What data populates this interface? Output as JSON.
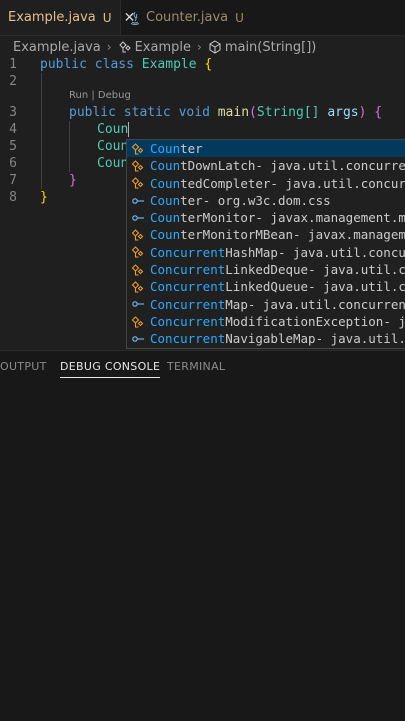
{
  "tabs": [
    {
      "name": "Example.java",
      "mark": "U",
      "close": "✕"
    },
    {
      "name": "Counter.java",
      "mark": "U"
    }
  ],
  "breadcrumb": {
    "file": "Example.java",
    "cls": "Example",
    "method": "main(String[])",
    "sep": "›"
  },
  "code": {
    "line_numbers": [
      "1",
      "2",
      "3",
      "4",
      "5",
      "6",
      "7",
      "8"
    ],
    "codelens": "Run | Debug",
    "l1_kw1": "public",
    "l1_kw2": "class",
    "l1_cls": "Example",
    "l1_brace": "{",
    "l3_kw1": "public",
    "l3_kw2": "static",
    "l3_kw3": "void",
    "l3_fn": "main",
    "l3_open": "(",
    "l3_type": "String[]",
    "l3_param": "args",
    "l3_close": ")",
    "l3_brace": "{",
    "l4_text": "Coun",
    "l5_text": "Coun",
    "l6_text": "Coun",
    "l7_brace": "}",
    "l8_brace": "}"
  },
  "suggestions": [
    {
      "icon": "class-icon",
      "match": "Coun",
      "rest": "ter",
      "detail": ""
    },
    {
      "icon": "class-icon",
      "match": "Coun",
      "rest": "tDownLatch",
      "detail": " - java.util.concurrent"
    },
    {
      "icon": "class-icon",
      "match": "Coun",
      "rest": "tedCompleter",
      "detail": " - java.util.concurrent"
    },
    {
      "icon": "interface-icon",
      "match": "Coun",
      "rest": "ter",
      "detail": " - org.w3c.dom.css"
    },
    {
      "icon": "interface-icon",
      "match": "Coun",
      "rest": "terMonitor",
      "detail": " - javax.management.monitor"
    },
    {
      "icon": "class-icon",
      "match": "Coun",
      "rest": "terMonitorMBean",
      "detail": " - javax.management.monitor"
    },
    {
      "icon": "class-icon",
      "match": "Concurrent",
      "rest": "HashMap",
      "detail": " - java.util.concurrent"
    },
    {
      "icon": "class-icon",
      "match": "Concurrent",
      "rest": "LinkedDeque",
      "detail": " - java.util.concurrent"
    },
    {
      "icon": "class-icon",
      "match": "Concurrent",
      "rest": "LinkedQueue",
      "detail": " - java.util.concurrent"
    },
    {
      "icon": "interface-icon",
      "match": "Concurrent",
      "rest": "Map",
      "detail": " - java.util.concurrent"
    },
    {
      "icon": "class-icon",
      "match": "Concurrent",
      "rest": "ModificationException",
      "detail": " - java.util"
    },
    {
      "icon": "interface-icon",
      "match": "Concurrent",
      "rest": "NavigableMap",
      "detail": " - java.util.concurrent"
    }
  ],
  "panel_tabs": [
    "OUTPUT",
    "DEBUG CONSOLE",
    "TERMINAL"
  ],
  "colors": {
    "accent": "#04395e",
    "match": "#2aaaff",
    "modified": "#e2c08d",
    "class_icon": "#ee9d28",
    "interface_icon": "#75beff"
  }
}
